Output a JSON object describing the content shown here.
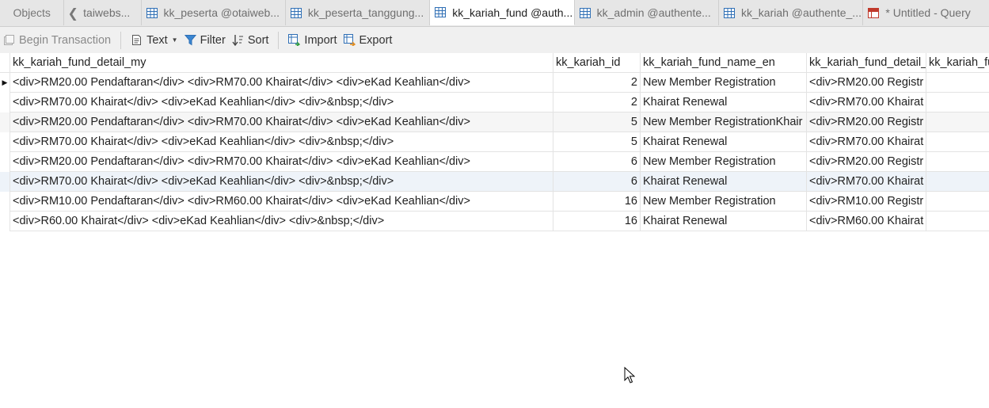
{
  "tabs": [
    {
      "label": "Objects"
    },
    {
      "label": "taiwebs..."
    },
    {
      "label": "kk_peserta @otaiweb..."
    },
    {
      "label": "kk_peserta_tanggung..."
    },
    {
      "label": "kk_kariah_fund @auth..."
    },
    {
      "label": "kk_admin @authente..."
    },
    {
      "label": "kk_kariah @authente_..."
    },
    {
      "label": "* Untitled - Query"
    }
  ],
  "toolbar": {
    "begin_transaction": "Begin Transaction",
    "text": "Text",
    "filter": "Filter",
    "sort": "Sort",
    "import": "Import",
    "export": "Export"
  },
  "columns": [
    "kk_kariah_fund_detail_my",
    "kk_kariah_id",
    "kk_kariah_fund_name_en",
    "kk_kariah_fund_detail_",
    "kk_kariah_fu"
  ],
  "rows": [
    [
      "<div>RM20.00 Pendaftaran</div> <div>RM70.00 Khairat</div> <div>eKad Keahlian</div>",
      "2",
      "New Member Registration",
      "<div>RM20.00 Registr",
      ""
    ],
    [
      "<div>RM70.00 Khairat</div> <div>eKad Keahlian</div> <div>&nbsp;</div>",
      "2",
      "Khairat Renewal",
      "<div>RM70.00 Khairat",
      ""
    ],
    [
      "<div>RM20.00 Pendaftaran</div> <div>RM70.00 Khairat</div> <div>eKad Keahlian</div>",
      "5",
      "New Member RegistrationKhair",
      "<div>RM20.00 Registr",
      ""
    ],
    [
      "<div>RM70.00 Khairat</div> <div>eKad Keahlian</div> <div>&nbsp;</div>",
      "5",
      "Khairat Renewal",
      "<div>RM70.00 Khairat",
      ""
    ],
    [
      "<div>RM20.00 Pendaftaran</div> <div>RM70.00 Khairat</div> <div>eKad Keahlian</div>",
      "6",
      "New Member Registration",
      "<div>RM20.00 Registr",
      ""
    ],
    [
      "<div>RM70.00 Khairat</div> <div>eKad Keahlian</div> <div>&nbsp;</div>",
      "6",
      "Khairat Renewal",
      "<div>RM70.00 Khairat",
      ""
    ],
    [
      "<div>RM10.00 Pendaftaran</div> <div>RM60.00 Khairat</div> <div>eKad Keahlian</div>",
      "16",
      "New Member Registration",
      "<div>RM10.00 Registr",
      ""
    ],
    [
      "<div>R60.00 Khairat</div> <div>eKad Keahlian</div> <div>&nbsp;</div>",
      "16",
      "Khairat Renewal",
      "<div>RM60.00 Khairat",
      ""
    ]
  ],
  "colors": {
    "tabbar_bg": "#e6e6e6",
    "toolbar_bg": "#f0f0f0",
    "table_icon": "#2f6fb5",
    "query_icon": "#c0392b"
  }
}
